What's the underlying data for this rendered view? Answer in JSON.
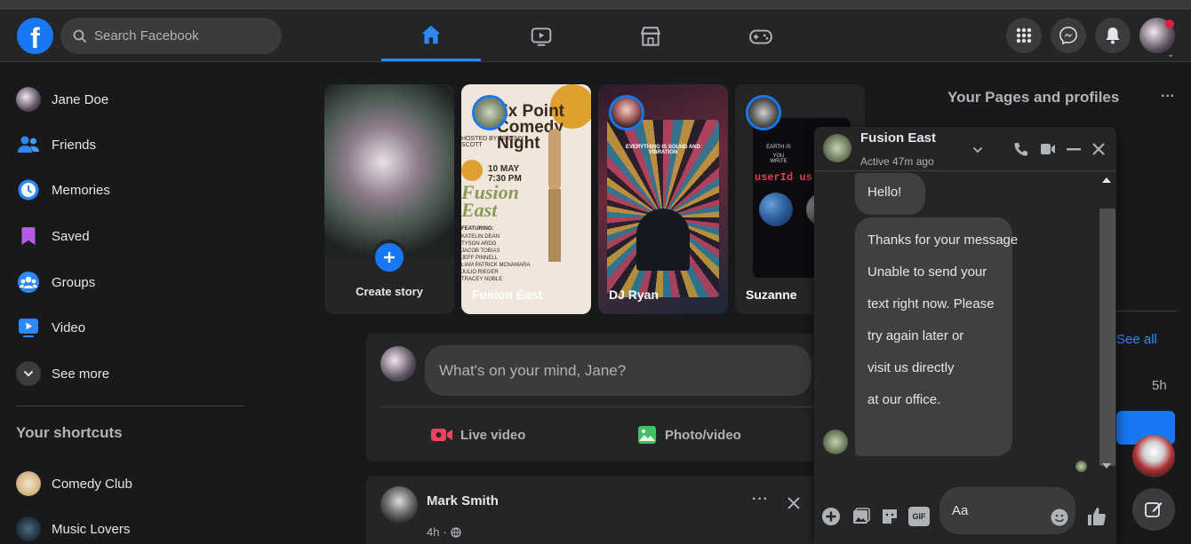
{
  "header": {
    "logo": "f",
    "search_placeholder": "Search Facebook",
    "nav_tabs": [
      {
        "name": "home",
        "icon": "home-icon",
        "active": true
      },
      {
        "name": "watch",
        "icon": "video-icon",
        "active": false
      },
      {
        "name": "marketplace",
        "icon": "marketplace-icon",
        "active": false
      },
      {
        "name": "gaming",
        "icon": "gamepad-icon",
        "active": false
      }
    ],
    "right_buttons": [
      "menu-grid-icon",
      "messenger-icon",
      "bell-icon"
    ]
  },
  "sidebar": {
    "items": [
      {
        "label": "Jane Doe"
      },
      {
        "label": "Friends"
      },
      {
        "label": "Memories"
      },
      {
        "label": "Saved"
      },
      {
        "label": "Groups"
      },
      {
        "label": "Video"
      },
      {
        "label": "See more"
      }
    ],
    "shortcuts_title": "Your shortcuts",
    "shortcuts": [
      {
        "label": "Comedy Club"
      },
      {
        "label": "Music Lovers"
      }
    ]
  },
  "stories": [
    {
      "label": "Create story",
      "type": "create"
    },
    {
      "label": "Fusion East",
      "type": "story",
      "poster_title": "Ex Point Comedy Night",
      "poster_host": "HOSTED BY JEREMY SCOTT",
      "poster_date": "10 MAY 7:30 PM",
      "poster_venue": "Fusion East",
      "poster_featuring_label": "FEATURING:",
      "poster_lineup": [
        "KATELIN DEAN",
        "TYSON ARDO",
        "JACOB TOBIAS",
        "JEFF PINNELL",
        "LIAM PATRICK MCNAMARA",
        "JULIO RIEGER",
        "TRACEY NOBLE"
      ]
    },
    {
      "label": "DJ Ryan",
      "type": "story",
      "poster_caption": "EVERYTHING IS SOUND AND VIBRATION"
    },
    {
      "label": "Suzanne",
      "type": "story",
      "poster_line1": "EARTH IS",
      "poster_line2": "YOU WRITE",
      "poster_code": "userId us"
    }
  ],
  "composer": {
    "prompt": "What's on your mind, Jane?",
    "actions": [
      {
        "label": "Live video",
        "icon": "live-video-icon",
        "color": "#f3425f"
      },
      {
        "label": "Photo/video",
        "icon": "photo-icon",
        "color": "#45bd62"
      }
    ]
  },
  "post": {
    "author": "Mark Smith",
    "time": "4h",
    "privacy_icon": "globe-icon"
  },
  "chat": {
    "name": "Fusion East",
    "status": "Active 47m ago",
    "messages": [
      "Hello!",
      "Thanks for your message",
      "Unable to send your",
      "text right now. Please",
      "try again later or",
      "visit us directly",
      "at our office."
    ],
    "input_placeholder": "Aa"
  },
  "right_panel": {
    "title": "Your Pages and profiles",
    "partial_text_1": "...",
    "partial_text_2": "See all",
    "partial_text_3": "5h"
  },
  "colors": {
    "accent": "#1877f2",
    "bg": "#18191a",
    "surface": "#242526",
    "surface2": "#3a3b3c",
    "text": "#e4e6eb",
    "muted": "#b0b3b8"
  }
}
